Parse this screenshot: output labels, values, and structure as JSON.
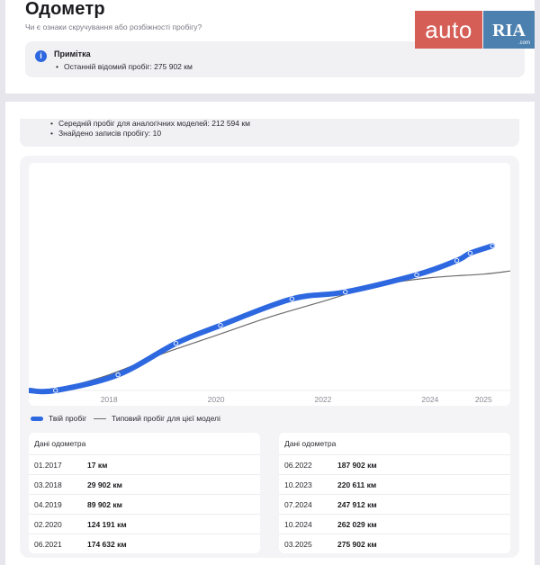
{
  "header": {
    "title": "Одометр",
    "subtitle": "Чи є ознаки скручування або розбіжності пробігу?"
  },
  "note": {
    "title": "Примітка",
    "last_mileage": "Останній відомий пробіг: 275 902 км",
    "icon": "info-icon"
  },
  "stats": {
    "avg_mileage": "Середній пробіг для аналогічних моделей: 212 594 км",
    "records_found": "Знайдено записів пробігу: 10"
  },
  "logo": {
    "auto": "auto",
    "ria": "RIA",
    "com": ".com"
  },
  "legend": {
    "yours": "Твій пробіг",
    "typical": "Типовий пробіг для цієї моделі"
  },
  "colors": {
    "accent": "#2e68e0",
    "typical_line": "#6b6b6b",
    "logo_red": "#d55e57",
    "logo_blue": "#4c80ae"
  },
  "chart_data": {
    "type": "line",
    "x_ticks": [
      "2018",
      "2020",
      "2022",
      "2024",
      "2025"
    ],
    "xlim": [
      2016.5,
      2025.5
    ],
    "ylim": [
      0,
      400000
    ],
    "grid": false,
    "series": [
      {
        "name": "Твій пробіг",
        "color": "#2e68e0",
        "points": [
          {
            "x": "01.2017",
            "y": 17
          },
          {
            "x": "03.2018",
            "y": 29902
          },
          {
            "x": "04.2019",
            "y": 89902
          },
          {
            "x": "02.2020",
            "y": 124191
          },
          {
            "x": "06.2021",
            "y": 174632
          },
          {
            "x": "06.2022",
            "y": 187902
          },
          {
            "x": "10.2023",
            "y": 220611
          },
          {
            "x": "07.2024",
            "y": 247912
          },
          {
            "x": "10.2024",
            "y": 262029
          },
          {
            "x": "03.2025",
            "y": 275902
          }
        ]
      },
      {
        "name": "Типовий пробіг для цієї моделі",
        "color": "#6b6b6b",
        "points": [
          {
            "x": "01.2017",
            "y": 0
          },
          {
            "x": "01.2018",
            "y": 30000
          },
          {
            "x": "01.2019",
            "y": 70000
          },
          {
            "x": "01.2020",
            "y": 105000
          },
          {
            "x": "01.2021",
            "y": 140000
          },
          {
            "x": "01.2022",
            "y": 170000
          },
          {
            "x": "01.2023",
            "y": 200000
          },
          {
            "x": "01.2024",
            "y": 215000
          },
          {
            "x": "01.2025",
            "y": 222000
          },
          {
            "x": "07.2025",
            "y": 228000
          }
        ]
      }
    ]
  },
  "odometer_tables": [
    {
      "header": "Дані одометра",
      "rows": [
        {
          "date": "01.2017",
          "km": "17 км"
        },
        {
          "date": "03.2018",
          "km": "29 902 км"
        },
        {
          "date": "04.2019",
          "km": "89 902 км"
        },
        {
          "date": "02.2020",
          "km": "124 191 км"
        },
        {
          "date": "06.2021",
          "km": "174 632 км"
        }
      ]
    },
    {
      "header": "Дані одометра",
      "rows": [
        {
          "date": "06.2022",
          "km": "187 902 км"
        },
        {
          "date": "10.2023",
          "km": "220 611 км"
        },
        {
          "date": "07.2024",
          "km": "247 912 км"
        },
        {
          "date": "10.2024",
          "km": "262 029 км"
        },
        {
          "date": "03.2025",
          "km": "275 902 км"
        }
      ]
    }
  ]
}
